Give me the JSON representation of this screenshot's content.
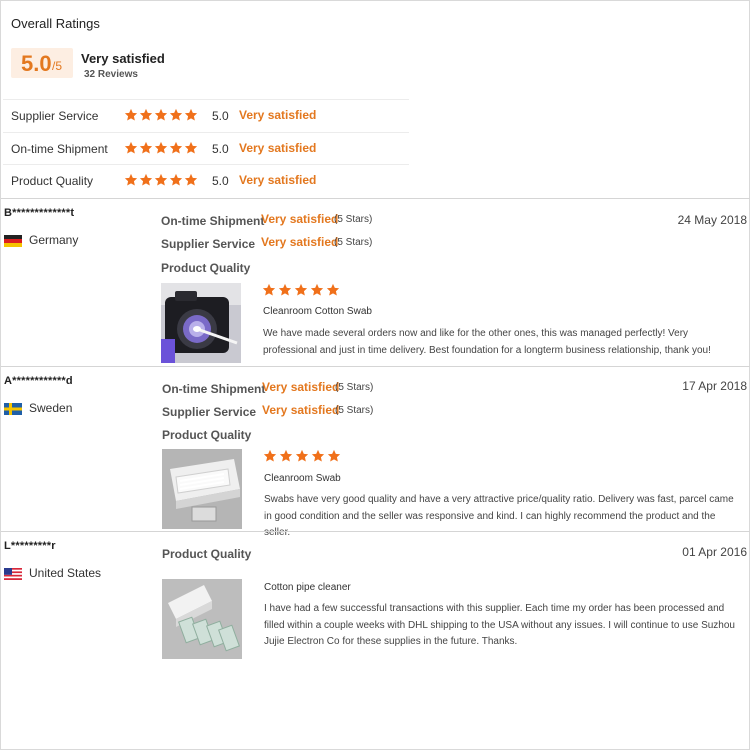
{
  "overall": {
    "title": "Overall Ratings",
    "score": "5.0",
    "score_max": "/5",
    "label": "Very satisfied",
    "reviews": "32 Reviews"
  },
  "ratings": [
    {
      "label": "Supplier Service",
      "stars": 5,
      "value": "5.0",
      "satisfaction": "Very satisfied"
    },
    {
      "label": "On-time Shipment",
      "stars": 5,
      "value": "5.0",
      "satisfaction": "Very satisfied"
    },
    {
      "label": "Product Quality",
      "stars": 5,
      "value": "5.0",
      "satisfaction": "Very satisfied"
    }
  ],
  "colors": {
    "accent": "#e3781f",
    "star": "#f0701a",
    "score_bg": "#fdeee2"
  },
  "icons": {
    "star": "star-icon",
    "flag": "flag-icon"
  },
  "reviews": [
    {
      "reviewer": "B*************t",
      "country": "Germany",
      "flag": "de",
      "date": "24 May 2018",
      "on_time_label": "On-time Shipment",
      "on_time_value": "Very satisfied",
      "on_time_stars": "(5 Stars)",
      "supplier_label": "Supplier Service",
      "supplier_value": "Very satisfied",
      "supplier_stars": "(5 Stars)",
      "quality_label": "Product Quality",
      "product_stars": 5,
      "product": "Cleanroom Cotton Swab",
      "comment": "We have made several orders now and like for the other ones, this was managed perfectly! Very professional and just in time delivery. Best foundation for a longterm business relationship, thank you!"
    },
    {
      "reviewer": "A************d",
      "country": "Sweden",
      "flag": "se",
      "date": "17 Apr 2018",
      "on_time_label": "On-time Shipment",
      "on_time_value": "Very satisfied",
      "on_time_stars": "(5 Stars)",
      "supplier_label": "Supplier Service",
      "supplier_value": "Very satisfied",
      "supplier_stars": "(5 Stars)",
      "quality_label": "Product Quality",
      "product_stars": 5,
      "product": "Cleanroom Swab",
      "comment": "Swabs have very good quality and have a very attractive price/quality ratio. Delivery was fast, parcel came in good condition and the seller was responsive and kind. I can highly recommend the product and the seller."
    },
    {
      "reviewer": "L*********r",
      "country": "United States",
      "flag": "us",
      "date": "01 Apr 2016",
      "quality_label": "Product Quality",
      "product": "Cotton pipe cleaner",
      "comment": "I have had a few successful transactions with this supplier. Each time my order has been processed and filled within a couple weeks with DHL shipping to the USA without any issues. I will continue to use Suzhou Jujie Electron Co for these supplies in the future. Thanks."
    }
  ]
}
